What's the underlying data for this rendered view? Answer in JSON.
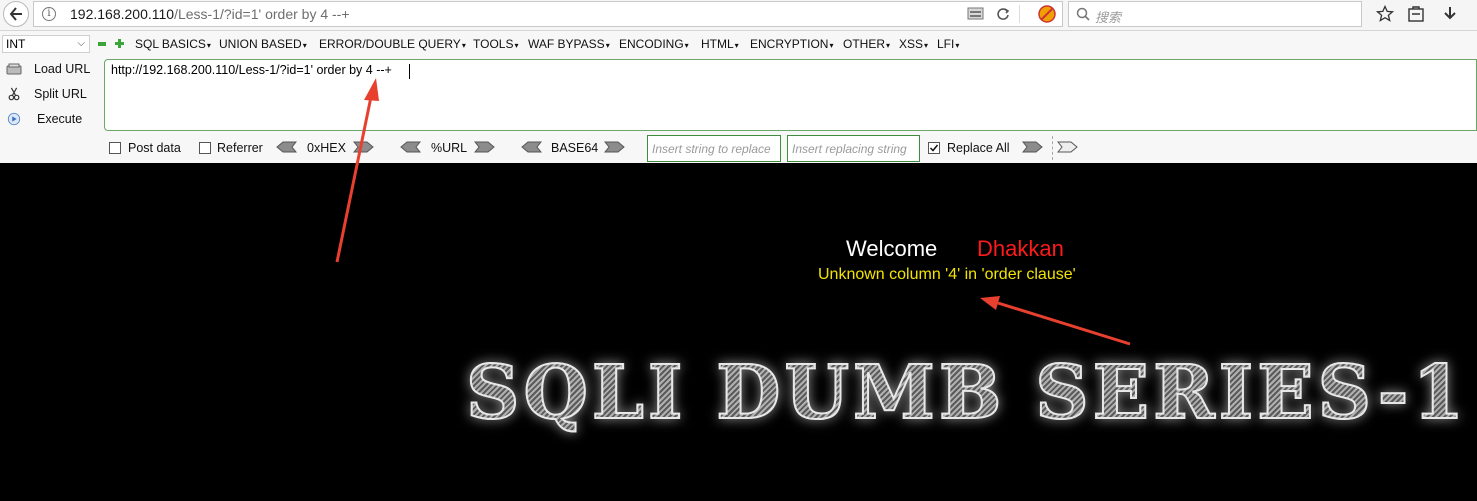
{
  "navbar": {
    "url_host": "192.168.200.110",
    "url_path": "/Less-1/?id=1' order by 4 --+",
    "search_placeholder": "搜索"
  },
  "hackbar": {
    "type_select": "INT",
    "menus": [
      "SQL BASICS",
      "UNION BASED",
      "ERROR/DOUBLE QUERY",
      "TOOLS",
      "WAF BYPASS",
      "ENCODING",
      "HTML",
      "ENCRYPTION",
      "OTHER",
      "XSS",
      "LFI"
    ],
    "load_url": "Load URL",
    "split_url": "Split URL",
    "execute": "Execute",
    "url_value": "http://192.168.200.110/Less-1/?id=1' order by 4 --+",
    "post_data": "Post data",
    "referrer": "Referrer",
    "hex": "0xHEX",
    "url_enc": "%URL",
    "base64": "BASE64",
    "replace_string_placeholder": "Insert string to replace",
    "replacing_string_placeholder": "Insert replacing string",
    "replace_all": "Replace All",
    "replace_all_checked": true
  },
  "page": {
    "welcome": "Welcome",
    "username": "Dhakkan",
    "error": "Unknown column '4' in 'order clause'",
    "banner": "SQLI DUMB SERIES-1"
  },
  "colors": {
    "page_bg": "#000000",
    "username": "#ff1a1a",
    "error": "#f2e400",
    "annotation_arrow": "#e8402f"
  }
}
